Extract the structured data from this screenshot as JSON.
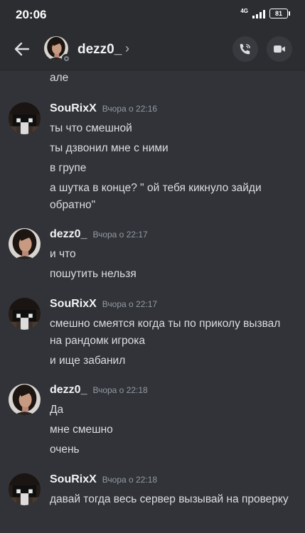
{
  "status_bar": {
    "time": "20:06",
    "network": "4G",
    "battery": "81"
  },
  "header": {
    "username": "dezz0_",
    "chevron": "›",
    "call_icon": "phone-icon",
    "video_icon": "video-camera-icon"
  },
  "partial_message": "але",
  "messages": [
    {
      "author": "SouRixX",
      "timestamp": "Вчора о 22:16",
      "avatar": "minecraft-skin-avatar",
      "lines": [
        "ты что смешной",
        "ты дзвонил мне с ними",
        "в групе",
        "а шутка в конце? \" ой тебя кикнуло зайди обратно\""
      ]
    },
    {
      "author": "dezz0_",
      "timestamp": "Вчора о 22:17",
      "avatar": "woman-portrait-avatar",
      "lines": [
        "и что",
        "пошутить нельзя"
      ]
    },
    {
      "author": "SouRixX",
      "timestamp": "Вчора о 22:17",
      "avatar": "minecraft-skin-avatar",
      "lines": [
        "смешно смеятся когда ты по приколу вызвал на рандомк игрока",
        "и ище забанил"
      ]
    },
    {
      "author": "dezz0_",
      "timestamp": "Вчора о 22:18",
      "avatar": "woman-portrait-avatar",
      "lines": [
        "Да",
        "мне смешно",
        "очень"
      ]
    },
    {
      "author": "SouRixX",
      "timestamp": "Вчора о 22:18",
      "avatar": "minecraft-skin-avatar",
      "lines": [
        "давай тогда весь сервер вызывай на проверку"
      ]
    }
  ],
  "colors": {
    "background": "#313338",
    "header": "#2b2d31",
    "text": "#dbdee1",
    "muted": "#949ba4"
  }
}
